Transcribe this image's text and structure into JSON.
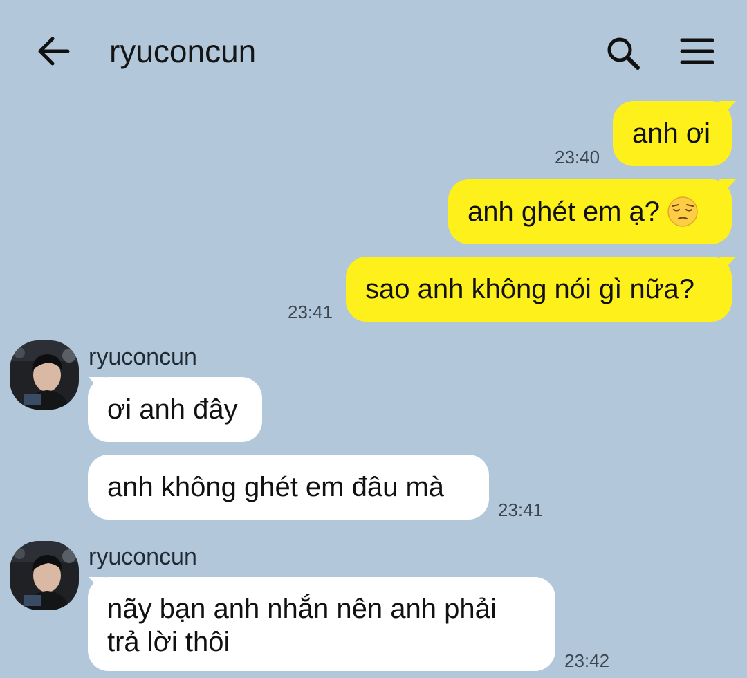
{
  "header": {
    "title": "ryuconcun",
    "back_icon": "back-arrow-icon",
    "search_icon": "search-icon",
    "menu_icon": "hamburger-menu-icon"
  },
  "colors": {
    "background": "#b2c7da",
    "outgoing_bubble": "#fef01b",
    "incoming_bubble": "#ffffff"
  },
  "messages": [
    {
      "direction": "out",
      "text": "anh ơi",
      "time": "23:40"
    },
    {
      "direction": "out",
      "text": "anh ghét em ạ?",
      "emoji": "pensive-face-emoji",
      "time": ""
    },
    {
      "direction": "out",
      "text": "sao anh không nói gì nữa?",
      "time": "23:41"
    },
    {
      "direction": "in",
      "sender": "ryuconcun",
      "text": "ơi anh đây",
      "time": ""
    },
    {
      "direction": "in",
      "text": "anh không ghét em đâu mà",
      "time": "23:41"
    },
    {
      "direction": "in",
      "sender": "ryuconcun",
      "text_lines": [
        "nãy bạn anh nhắn nên anh phải",
        "trả lời thôi"
      ],
      "time": "23:42"
    }
  ]
}
